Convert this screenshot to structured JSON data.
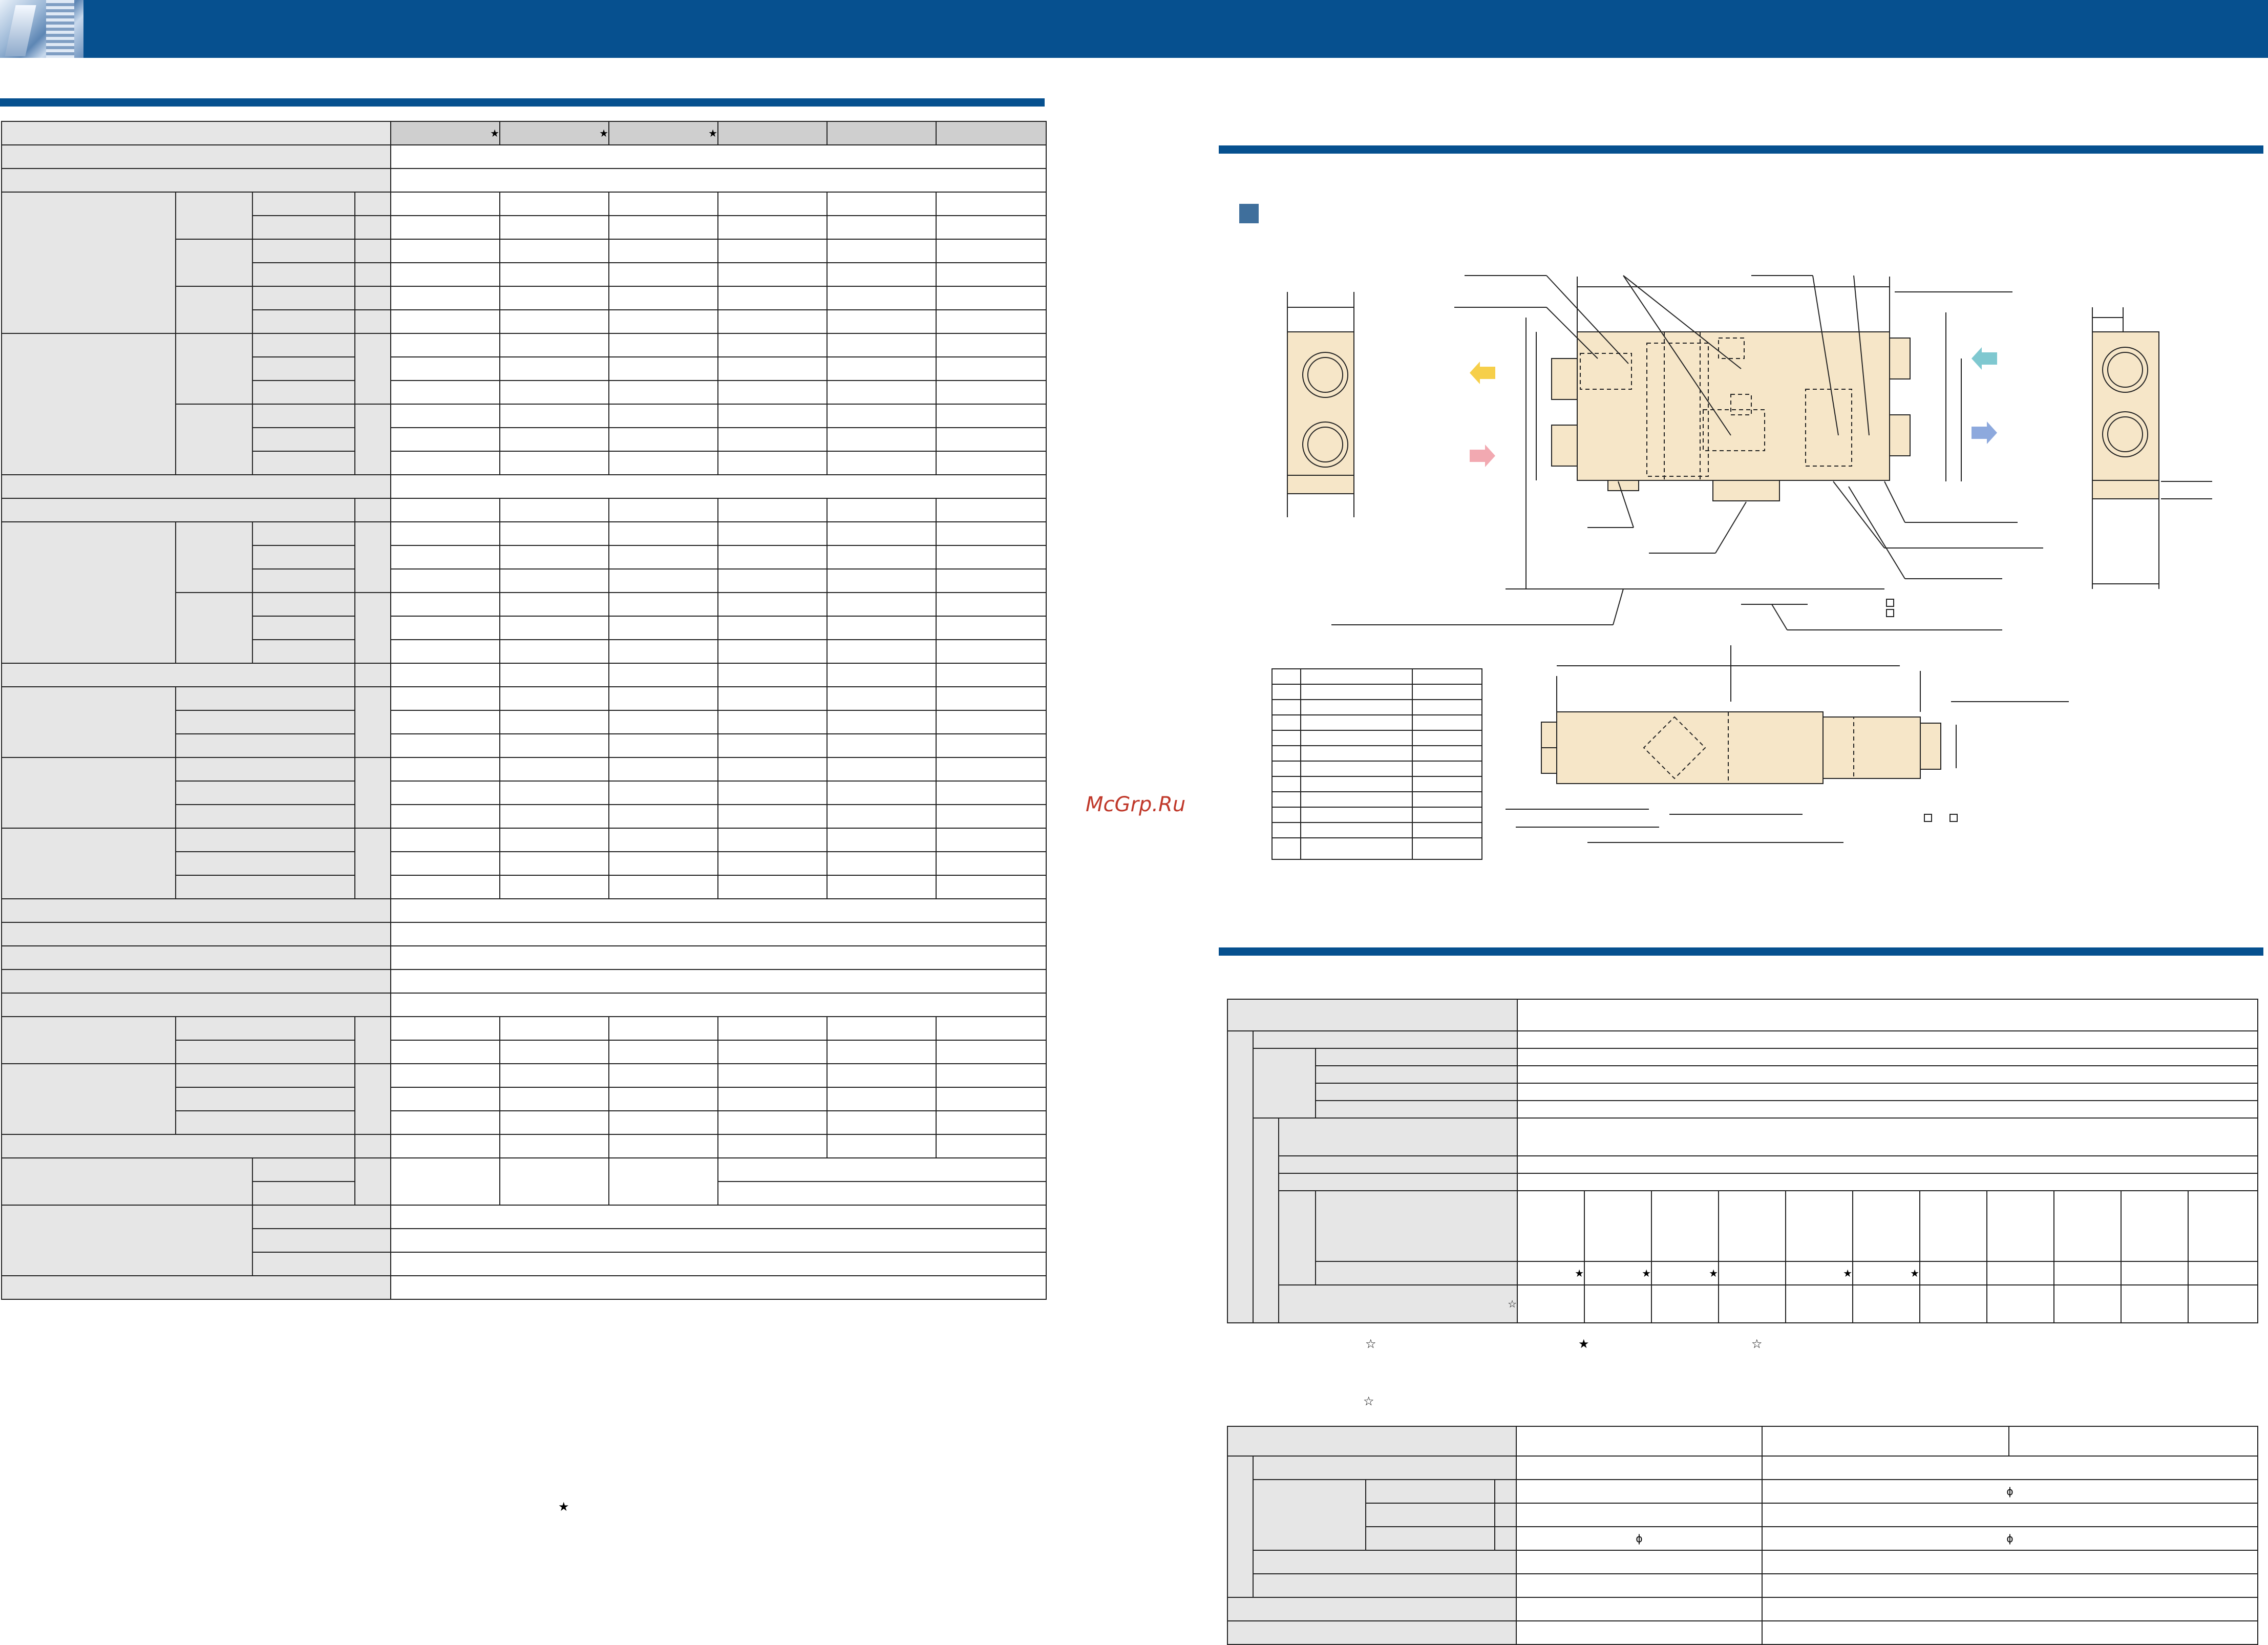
{
  "watermark": "McGrp.Ru",
  "marks": {
    "star": "★",
    "star_outline": "☆",
    "phi": "ϕ",
    "box": "□"
  },
  "colors": {
    "brand_blue": "#06508f",
    "body_color": "#f6e6c8",
    "arrow_yellow": "#f6cf4a",
    "arrow_pink": "#f2a9b1",
    "arrow_teal": "#7fc8d0",
    "arrow_blue": "#8da9dd",
    "section_square": "#3f6f9c"
  },
  "icons": [
    "building-photo",
    "section-square-marker",
    "airflow-arrow-icon"
  ]
}
